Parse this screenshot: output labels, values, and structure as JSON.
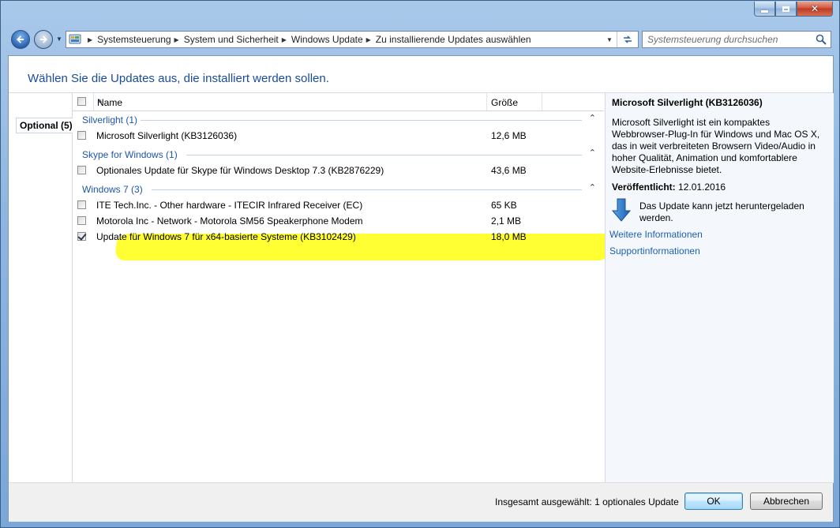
{
  "window": {
    "caption_buttons": [
      "minimize",
      "maximize",
      "close"
    ]
  },
  "nav": {
    "breadcrumbs": [
      "Systemsteuerung",
      "System und Sicherheit",
      "Windows Update",
      "Zu installierende Updates auswählen"
    ],
    "search_placeholder": "Systemsteuerung durchsuchen"
  },
  "page": {
    "heading": "Wählen Sie die Updates aus, die installiert werden sollen.",
    "tab": "Optional (5)"
  },
  "list": {
    "columns": {
      "name": "Name",
      "size": "Größe"
    },
    "groups": [
      {
        "label": "Silverlight (1)",
        "items": [
          {
            "name": "Microsoft Silverlight (KB3126036)",
            "size": "12,6 MB",
            "checked": false
          }
        ]
      },
      {
        "label": "Skype for Windows (1)",
        "items": [
          {
            "name": "Optionales Update für Skype für Windows Desktop 7.3 (KB2876229)",
            "size": "43,6 MB",
            "checked": false
          }
        ]
      },
      {
        "label": "Windows 7 (3)",
        "items": [
          {
            "name": "ITE Tech.Inc. - Other hardware - ITECIR Infrared Receiver (EC)",
            "size": "65 KB",
            "checked": false
          },
          {
            "name": "Motorola Inc - Network - Motorola SM56 Speakerphone Modem",
            "size": "2,1 MB",
            "checked": false
          },
          {
            "name": "Update für Windows 7 für x64-basierte Systeme (KB3102429)",
            "size": "18,0 MB",
            "checked": true
          }
        ]
      }
    ],
    "highlight_color": "#ffff33"
  },
  "details": {
    "title": "Microsoft Silverlight (KB3126036)",
    "description": "Microsoft Silverlight ist ein kompaktes Webbrowser-Plug-In für Windows und Mac OS X, das in weit verbreiteten Browsern Video/Audio in hoher Qualität, Animation und komfortablere Website-Erlebnisse bietet.",
    "published_label": "Veröffentlicht:",
    "published_value": "12.01.2016",
    "download_text": "Das Update kann jetzt heruntergeladen werden.",
    "link_more": "Weitere Informationen",
    "link_support": "Supportinformationen",
    "icon": "download-arrow-icon"
  },
  "footer": {
    "total": "Insgesamt ausgewählt: 1 optionales Update",
    "ok": "OK",
    "cancel": "Abbrechen"
  },
  "colors": {
    "heading": "#1a4b9b",
    "group_label": "#1f55a8",
    "link": "#1e5fb4"
  }
}
